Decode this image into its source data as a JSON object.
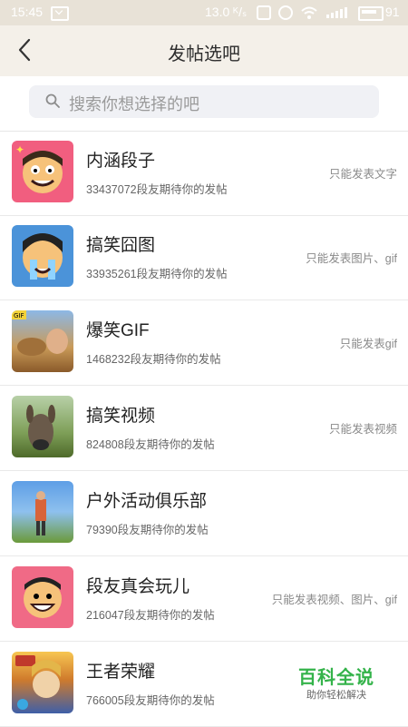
{
  "statusbar": {
    "time": "15:45",
    "speed": "13.0 ᴷ/ₛ",
    "battery": "91"
  },
  "header": {
    "title": "发帖选吧"
  },
  "search": {
    "placeholder": "搜索你想选择的吧"
  },
  "items": [
    {
      "name": "内涵段子",
      "sub": "33437072段友期待你的发帖",
      "note": "只能发表文字",
      "icon": "funny-face-icon",
      "color": "#f15e7f"
    },
    {
      "name": "搞笑囧图",
      "sub": "33935261段友期待你的发帖",
      "note": "只能发表图片、gif",
      "icon": "crying-face-icon",
      "color": "#4b93d9"
    },
    {
      "name": "爆笑GIF",
      "sub": "1468232段友期待你的发帖",
      "note": "只能发表gif",
      "icon": "camel-photo-icon",
      "color": "#c98a3a"
    },
    {
      "name": "搞笑视频",
      "sub": "824808段友期待你的发帖",
      "note": "只能发表视频",
      "icon": "donkey-photo-icon",
      "color": "#6b8a3c"
    },
    {
      "name": "户外活动俱乐部",
      "sub": "79390段友期待你的发帖",
      "note": "",
      "icon": "hiker-photo-icon",
      "color": "#4f8ad6"
    },
    {
      "name": "段友真会玩儿",
      "sub": "216047段友期待你的发帖",
      "note": "只能发表视频、图片、gif",
      "icon": "smiling-face-icon",
      "color": "#f06a86"
    },
    {
      "name": "王者荣耀",
      "sub": "766005段友期待你的发帖",
      "note": "",
      "icon": "game-character-icon",
      "color": "#c0392b"
    }
  ],
  "watermark": {
    "title": "百科全说",
    "sub": "助你轻松解决"
  }
}
